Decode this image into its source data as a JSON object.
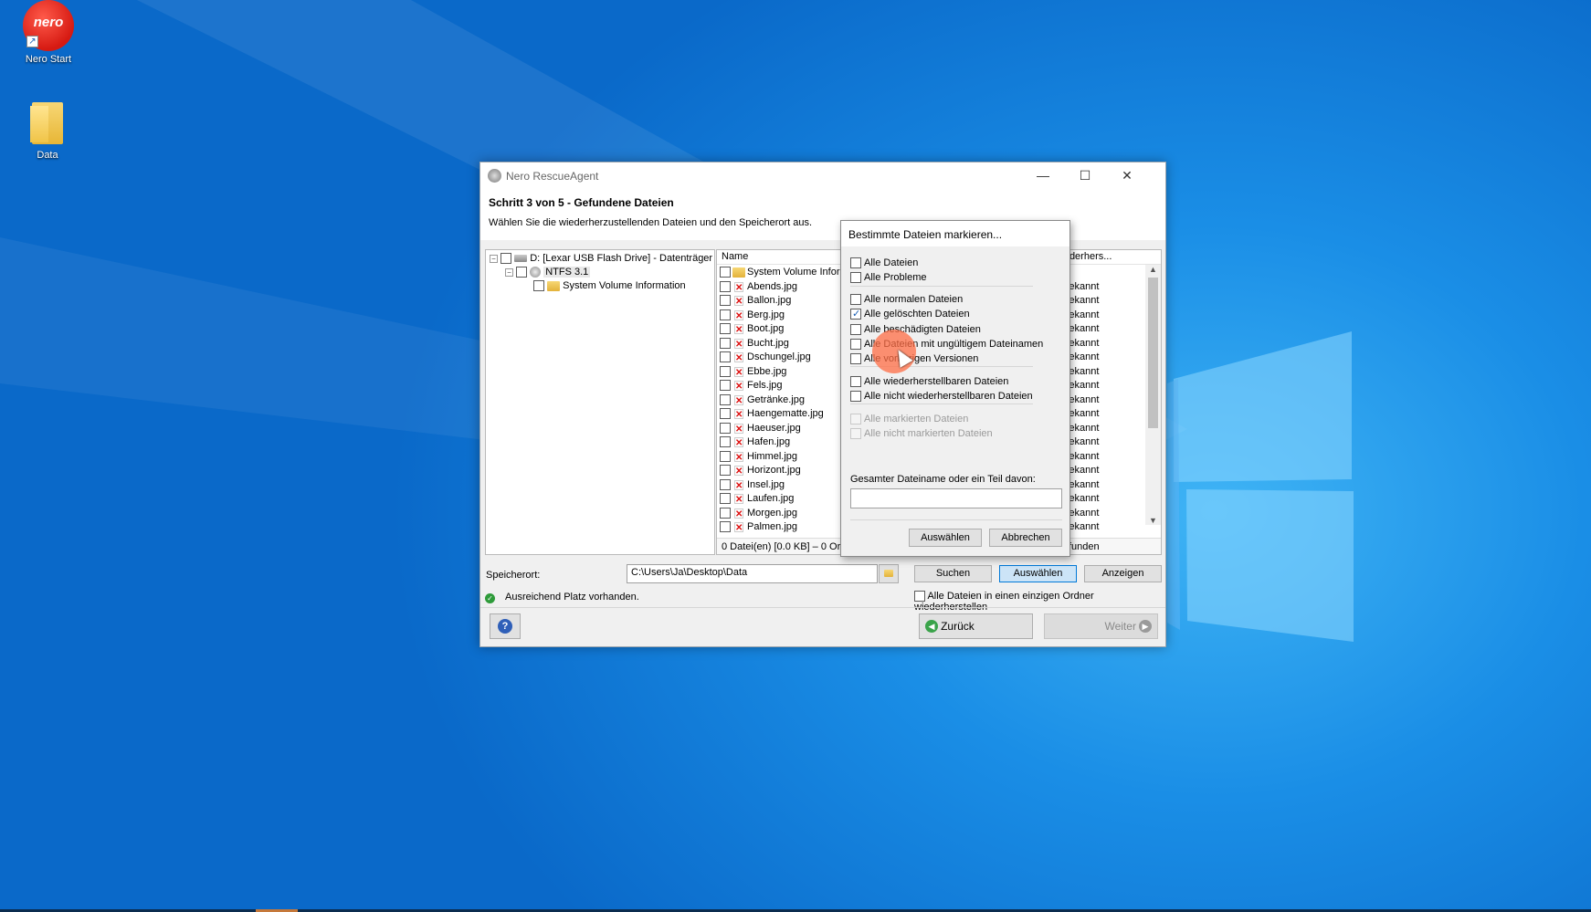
{
  "desktop": {
    "icons": [
      {
        "label": "Nero Start",
        "logo_text": "nero"
      },
      {
        "label": "Data"
      }
    ]
  },
  "window": {
    "title": "Nero RescueAgent",
    "step_title": "Schritt 3 von 5 - Gefundene Dateien",
    "subtitle": "Wählen Sie die wiederherzustellenden Dateien und den Speicherort aus.",
    "tree": {
      "drive": "D: [Lexar    USB Flash Drive] - Datenträger",
      "fs": "NTFS 3.1",
      "folder": "System Volume Information"
    },
    "list": {
      "col_name": "Name",
      "col_restore": "Wiederhers...",
      "rows": [
        {
          "name": "System Volume Inform",
          "status": "",
          "type": "folder"
        },
        {
          "name": "Abends.jpg",
          "status": "unbekannt",
          "type": "file"
        },
        {
          "name": "Ballon.jpg",
          "status": "unbekannt",
          "type": "file"
        },
        {
          "name": "Berg.jpg",
          "status": "unbekannt",
          "type": "file"
        },
        {
          "name": "Boot.jpg",
          "status": "unbekannt",
          "type": "file"
        },
        {
          "name": "Bucht.jpg",
          "status": "unbekannt",
          "type": "file"
        },
        {
          "name": "Dschungel.jpg",
          "status": "unbekannt",
          "type": "file"
        },
        {
          "name": "Ebbe.jpg",
          "status": "unbekannt",
          "type": "file"
        },
        {
          "name": "Fels.jpg",
          "status": "unbekannt",
          "type": "file"
        },
        {
          "name": "Getränke.jpg",
          "status": "unbekannt",
          "type": "file"
        },
        {
          "name": "Haengematte.jpg",
          "status": "unbekannt",
          "type": "file"
        },
        {
          "name": "Haeuser.jpg",
          "status": "unbekannt",
          "type": "file"
        },
        {
          "name": "Hafen.jpg",
          "status": "unbekannt",
          "type": "file"
        },
        {
          "name": "Himmel.jpg",
          "status": "unbekannt",
          "type": "file"
        },
        {
          "name": "Horizont.jpg",
          "status": "unbekannt",
          "type": "file"
        },
        {
          "name": "Insel.jpg",
          "status": "unbekannt",
          "type": "file"
        },
        {
          "name": "Laufen.jpg",
          "status": "unbekannt",
          "type": "file"
        },
        {
          "name": "Morgen.jpg",
          "status": "unbekannt",
          "type": "file"
        },
        {
          "name": "Palmen.jpg",
          "status": "unbekannt",
          "type": "file"
        }
      ],
      "status_left": "0 Datei(en) [0.0 KB] – 0 Ord",
      "status_right": "funden"
    },
    "storage_label": "Speicherort:",
    "storage_path": "C:\\Users\\Ja\\Desktop\\Data",
    "buttons": {
      "search": "Suchen",
      "select": "Auswählen",
      "show": "Anzeigen",
      "back": "Zurück",
      "next": "Weiter"
    },
    "space_ok": "Ausreichend Platz vorhanden.",
    "single_folder": "Alle Dateien in einen einzigen Ordner wiederherstellen"
  },
  "dialog": {
    "title": "Bestimmte Dateien markieren...",
    "options": [
      {
        "label": "Alle Dateien",
        "checked": false,
        "disabled": false
      },
      {
        "label": "Alle Probleme",
        "checked": false,
        "disabled": false
      },
      {
        "label": "Alle normalen Dateien",
        "checked": false,
        "disabled": false
      },
      {
        "label": "Alle gelöschten Dateien",
        "checked": true,
        "disabled": false
      },
      {
        "label": "Alle beschädigten Dateien",
        "checked": false,
        "disabled": false
      },
      {
        "label": "Alle Dateien mit ungültigem Dateinamen",
        "checked": false,
        "disabled": false
      },
      {
        "label": "Alle vorherigen Versionen",
        "checked": false,
        "disabled": false
      },
      {
        "label": "Alle wiederherstellbaren Dateien",
        "checked": false,
        "disabled": false
      },
      {
        "label": "Alle nicht wiederherstellbaren Dateien",
        "checked": false,
        "disabled": false
      },
      {
        "label": "Alle markierten Dateien",
        "checked": false,
        "disabled": true
      },
      {
        "label": "Alle nicht markierten Dateien",
        "checked": false,
        "disabled": true
      }
    ],
    "filename_label": "Gesamter Dateiname oder ein Teil davon:",
    "filename_value": "",
    "ok": "Auswählen",
    "cancel": "Abbrechen"
  },
  "colors": {
    "accent": "#0078d7",
    "desktop": "#0a69c9",
    "error_mark": "#dd1111"
  }
}
